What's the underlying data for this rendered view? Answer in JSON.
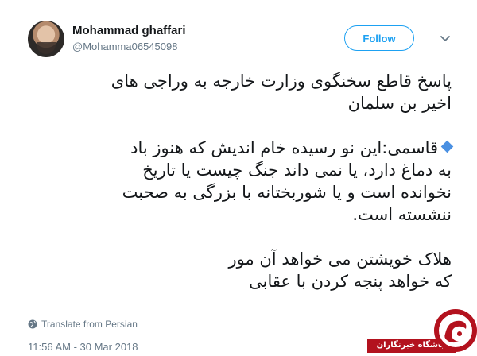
{
  "user": {
    "display_name": "Mohammad ghaffari",
    "handle": "@Mohamma06545098"
  },
  "actions": {
    "follow_label": "Follow"
  },
  "tweet": {
    "paragraphs": [
      [
        "پاسخ قاطع سخنگوی وزارت خارجه به وراجی های",
        "اخیر بن سلمان"
      ],
      [
        "قاسمی:این نو رسیده خام اندیش که هنوز باد",
        "به دماغ دارد، یا نمی داند جنگ چیست یا تاریخ",
        "نخوانده است و یا شوربختانه با بزرگی به صحبت",
        "ننشسته است."
      ],
      [
        "هلاک خویشتن می خواهد آن مور",
        "که خواهد پنجه کردن با عقابی"
      ]
    ]
  },
  "translate": {
    "label": "Translate from Persian"
  },
  "timestamp": "11:56 AM - 30 Mar 2018",
  "watermark": {
    "text": "باشگاه خبرنگاران",
    "color": "#b3121e"
  },
  "colors": {
    "accent": "#1da1f2",
    "diamond": "#4a90e2"
  },
  "icons": {
    "chevron": "chevron-down-icon",
    "globe": "globe-icon",
    "bullet": "blue-diamond-icon"
  }
}
